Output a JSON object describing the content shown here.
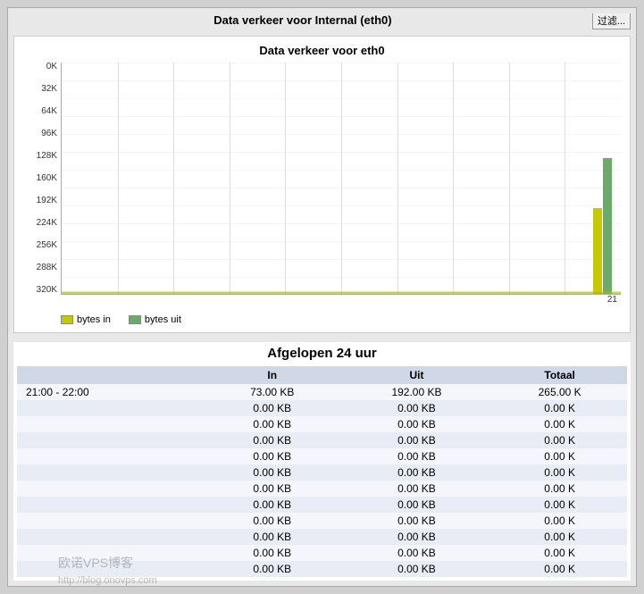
{
  "page": {
    "outer_title": "Data verkeer voor Internal (eth0)",
    "filter_button": "过滤...",
    "chart_title": "Data verkeer voor eth0",
    "y_labels": [
      "0K",
      "32K",
      "64K",
      "96K",
      "128K",
      "160K",
      "192K",
      "224K",
      "256K",
      "288K",
      "320K"
    ],
    "x_label": "21",
    "legend": {
      "bytes_in_label": "bytes in",
      "bytes_out_label": "bytes uit"
    },
    "bar": {
      "in_height_pct": 37,
      "out_height_pct": 58
    },
    "summary": {
      "title": "Afgelopen 24 uur",
      "columns": [
        "In",
        "Uit",
        "Totaal"
      ],
      "rows": [
        {
          "time": "21:00 - 22:00",
          "in": "73.00 KB",
          "out": "192.00 KB",
          "total": "265.00 K"
        },
        {
          "time": "",
          "in": "0.00 KB",
          "out": "0.00 KB",
          "total": "0.00 K"
        },
        {
          "time": "",
          "in": "0.00 KB",
          "out": "0.00 KB",
          "total": "0.00 K"
        },
        {
          "time": "",
          "in": "0.00 KB",
          "out": "0.00 KB",
          "total": "0.00 K"
        },
        {
          "time": "",
          "in": "0.00 KB",
          "out": "0.00 KB",
          "total": "0.00 K"
        },
        {
          "time": "",
          "in": "0.00 KB",
          "out": "0.00 KB",
          "total": "0.00 K"
        },
        {
          "time": "",
          "in": "0.00 KB",
          "out": "0.00 KB",
          "total": "0.00 K"
        },
        {
          "time": "",
          "in": "0.00 KB",
          "out": "0.00 KB",
          "total": "0.00 K"
        },
        {
          "time": "",
          "in": "0.00 KB",
          "out": "0.00 KB",
          "total": "0.00 K"
        },
        {
          "time": "",
          "in": "0.00 KB",
          "out": "0.00 KB",
          "total": "0.00 K"
        },
        {
          "time": "",
          "in": "0.00 KB",
          "out": "0.00 KB",
          "total": "0.00 K"
        },
        {
          "time": "",
          "in": "0.00 KB",
          "out": "0.00 KB",
          "total": "0.00 K"
        }
      ]
    },
    "watermark": {
      "text": "欧诺VPS博客",
      "url": "http://blog.onovps.com"
    }
  }
}
